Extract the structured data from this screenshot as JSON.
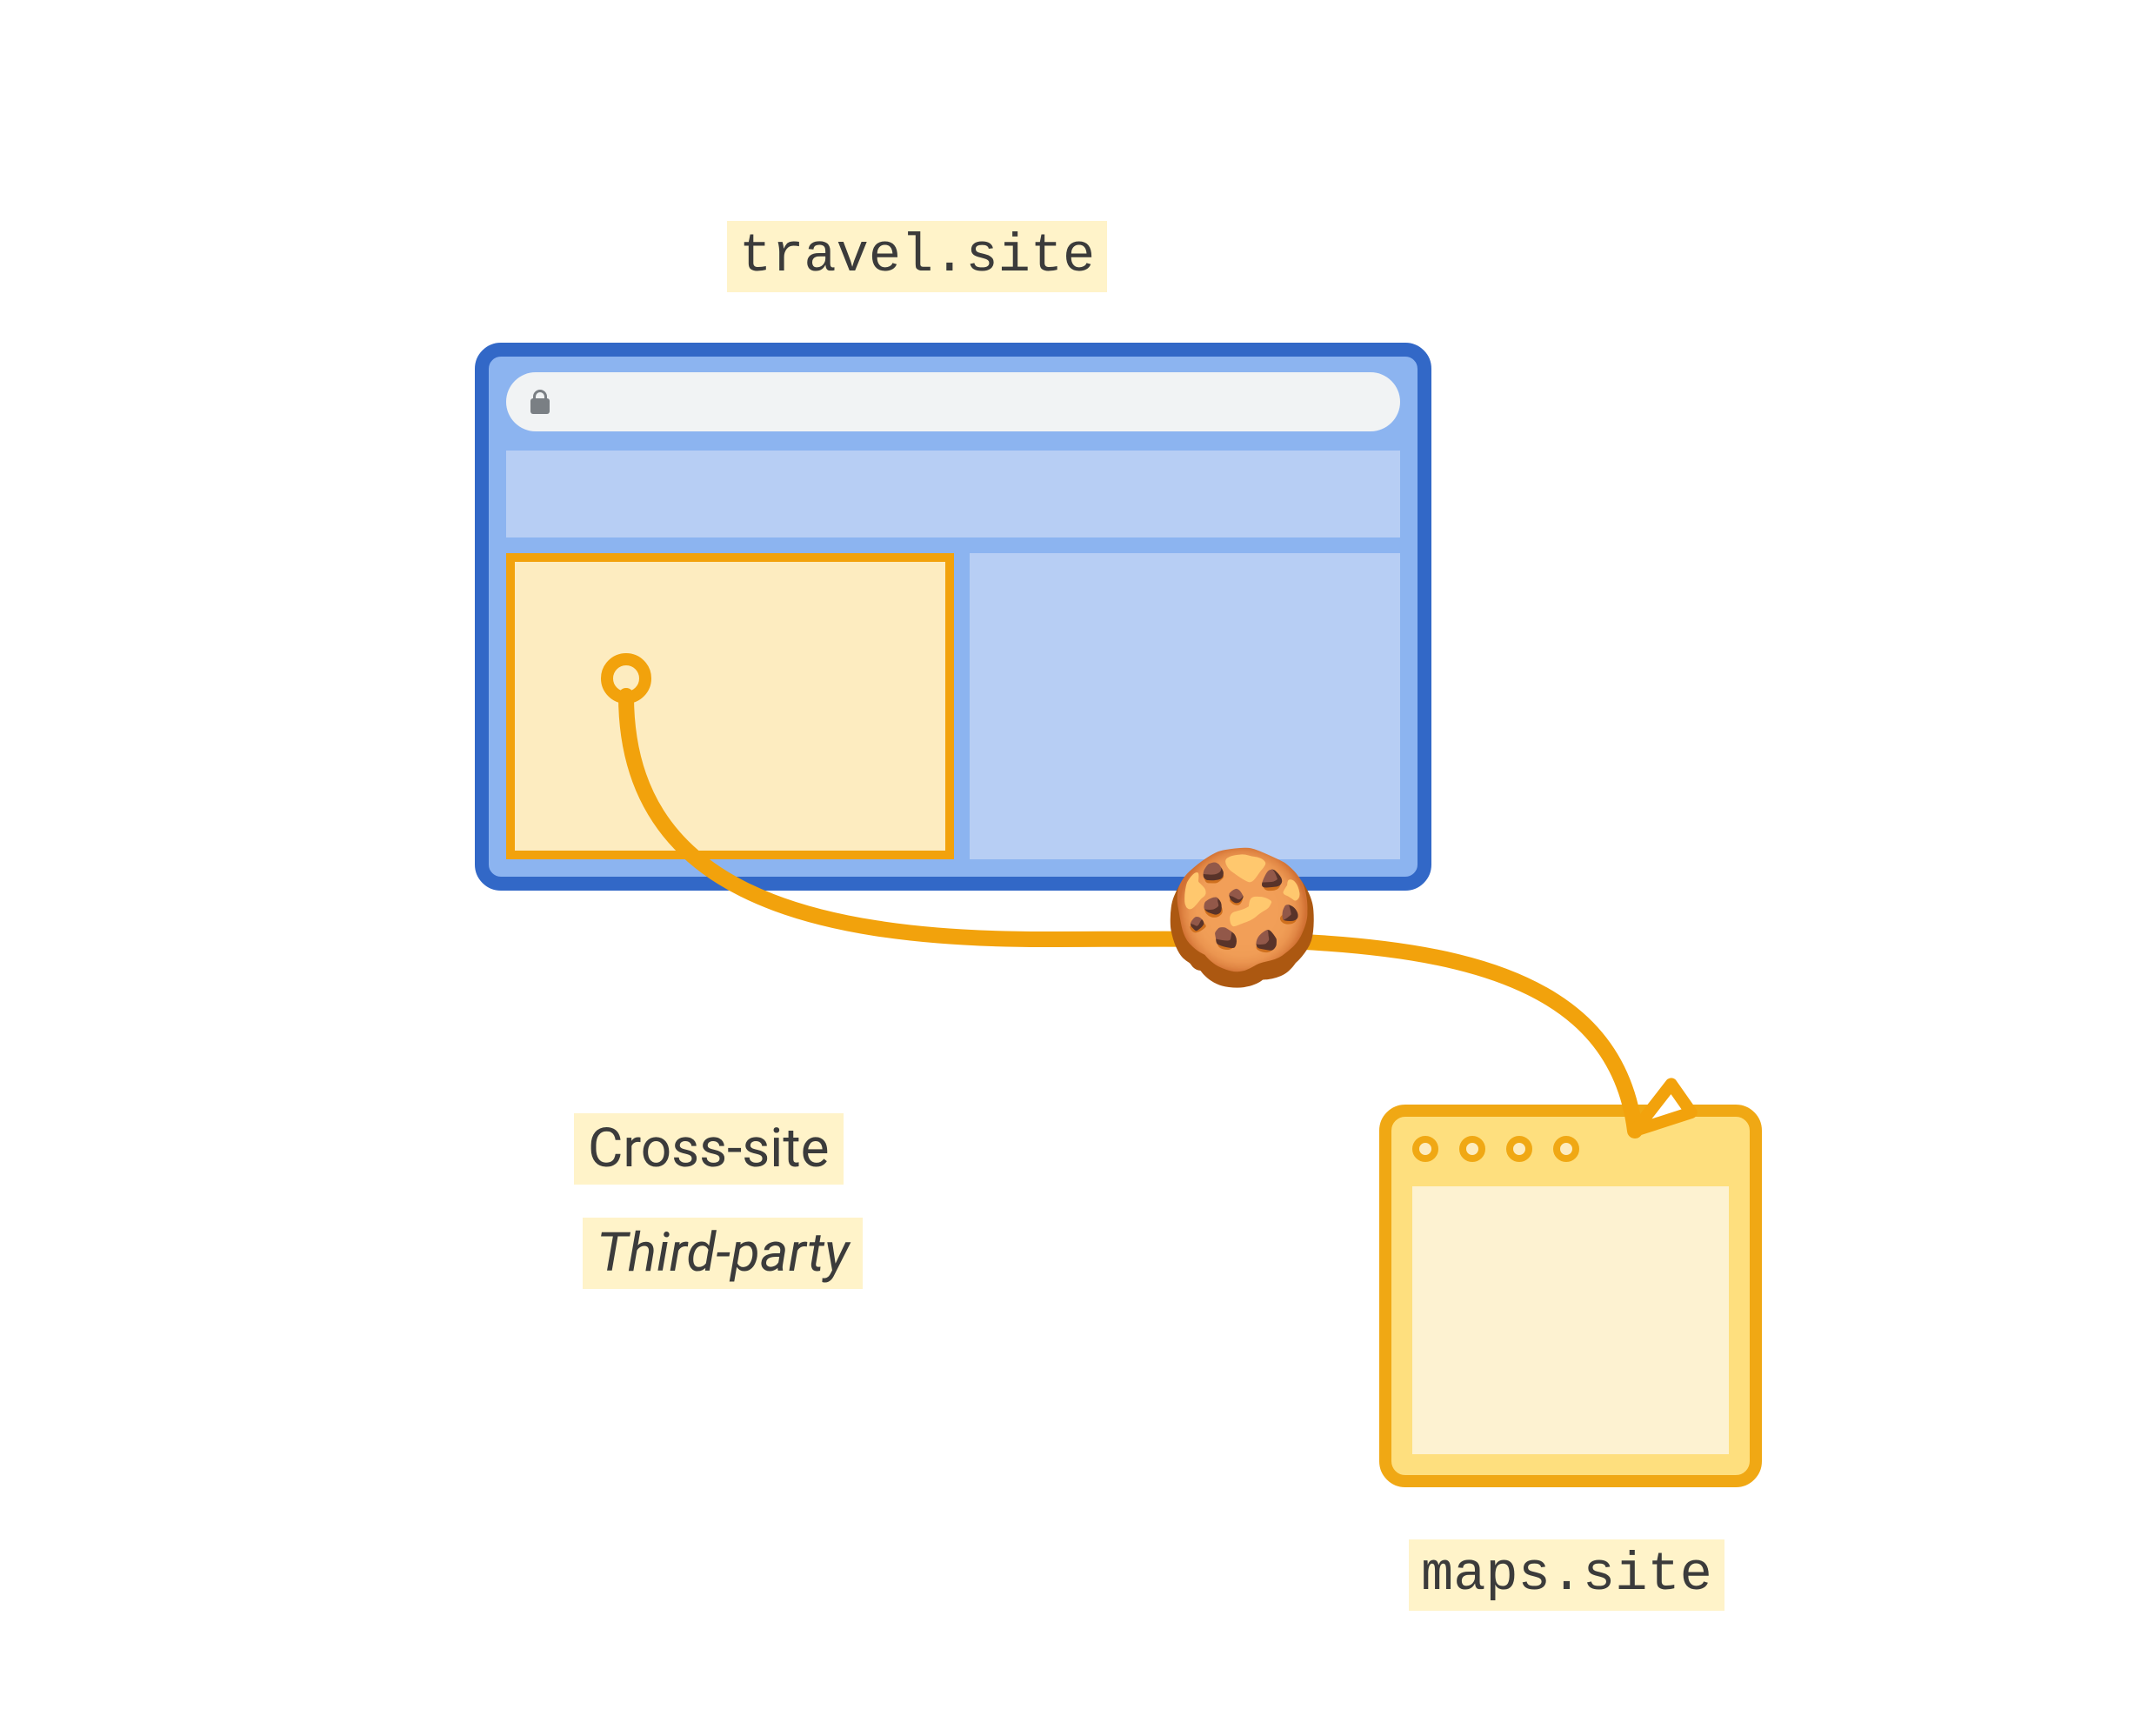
{
  "labels": {
    "site_primary": "travel.site",
    "site_thirdparty": "maps.site"
  },
  "captions": {
    "cross_site": "Cross-site",
    "third_party": "Third-party"
  },
  "icons": {
    "cookie": "🍪"
  },
  "colors": {
    "highlight_bg": "#fff3c9",
    "primary_window_border": "#3268c7",
    "primary_window_fill": "#8cb4f0",
    "primary_panel_fill": "#b7cef4",
    "accent_border": "#f0a814",
    "accent_dark": "#f2a20c",
    "accent_fill": "#fdecc0",
    "thirdparty_fill": "#fedf7e",
    "arrow": "#f2a20c"
  }
}
